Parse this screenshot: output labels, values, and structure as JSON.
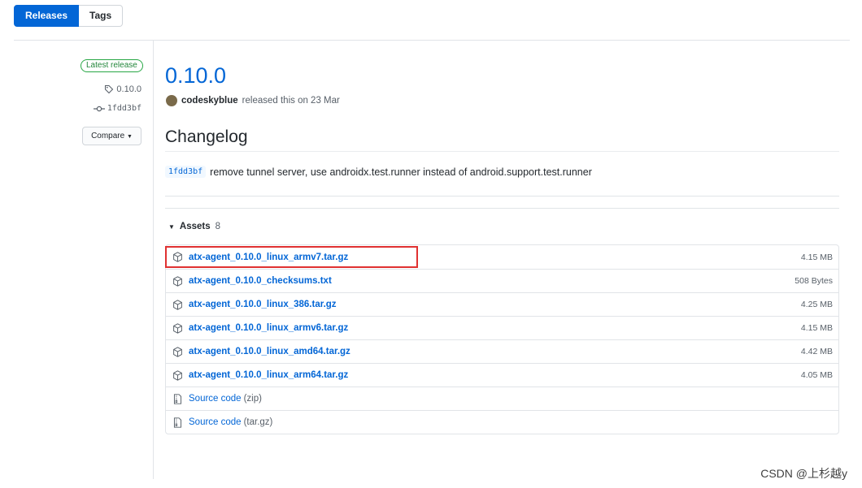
{
  "tabs": [
    {
      "label": "Releases",
      "active": true
    },
    {
      "label": "Tags",
      "active": false
    }
  ],
  "sidebar": {
    "badge": "Latest release",
    "tag": "0.10.0",
    "commit": "1fdd3bf",
    "compare_label": "Compare"
  },
  "release": {
    "title": "0.10.0",
    "author": "codeskyblue",
    "released_text": "released this on 23 Mar",
    "changelog_heading": "Changelog",
    "change_sha": "1fdd3bf",
    "change_text": "remove tunnel server, use androidx.test.runner instead of android.support.test.runner"
  },
  "assets": {
    "label": "Assets",
    "count": "8",
    "files": [
      {
        "name": "atx-agent_0.10.0_linux_armv7.tar.gz",
        "size": "4.15 MB"
      },
      {
        "name": "atx-agent_0.10.0_checksums.txt",
        "size": "508 Bytes"
      },
      {
        "name": "atx-agent_0.10.0_linux_386.tar.gz",
        "size": "4.25 MB"
      },
      {
        "name": "atx-agent_0.10.0_linux_armv6.tar.gz",
        "size": "4.15 MB"
      },
      {
        "name": "atx-agent_0.10.0_linux_amd64.tar.gz",
        "size": "4.42 MB"
      },
      {
        "name": "atx-agent_0.10.0_linux_arm64.tar.gz",
        "size": "4.05 MB"
      }
    ],
    "sources": [
      {
        "name": "Source code",
        "ext": "(zip)"
      },
      {
        "name": "Source code",
        "ext": "(tar.gz)"
      }
    ]
  },
  "icons": {
    "package": "package-icon",
    "archive": "file-zip-icon",
    "tag": "tag-icon",
    "commit": "git-commit-icon"
  },
  "colors": {
    "accent": "#0366d6",
    "badge_green": "#28a745",
    "highlight_red": "#e03131"
  },
  "watermark": "CSDN @上杉越y"
}
